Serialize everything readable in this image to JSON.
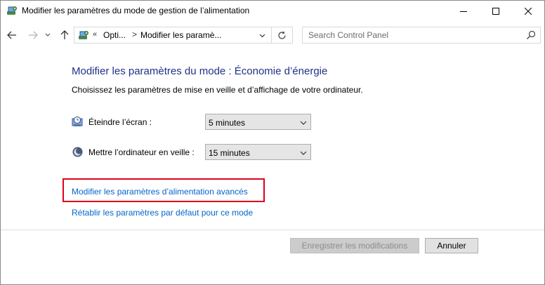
{
  "window": {
    "title": "Modifier les paramètres du mode de gestion de l’alimentation"
  },
  "address": {
    "overflow": "«",
    "crumbs": [
      "Opti...",
      "Modifier les paramè..."
    ],
    "separator": ">"
  },
  "search": {
    "placeholder": "Search Control Panel"
  },
  "main": {
    "title": "Modifier les paramètres du mode : Économie d’énergie",
    "subtitle": "Choisissez les paramètres de mise en veille et d’affichage de votre ordinateur.",
    "display": {
      "label": "Éteindre l’écran :",
      "value": "5 minutes"
    },
    "sleep": {
      "label": "Mettre l’ordinateur en veille :",
      "value": "15 minutes"
    },
    "links": {
      "advanced": "Modifier les paramètres d’alimentation avancés",
      "restore": "Rétablir les paramètres par défaut pour ce mode"
    }
  },
  "footer": {
    "save_label": "Enregistrer les modifications",
    "cancel_label": "Annuler"
  },
  "colors": {
    "title_blue": "#1e3287",
    "link_blue": "#0066cc",
    "highlight_red": "#e0001b"
  }
}
